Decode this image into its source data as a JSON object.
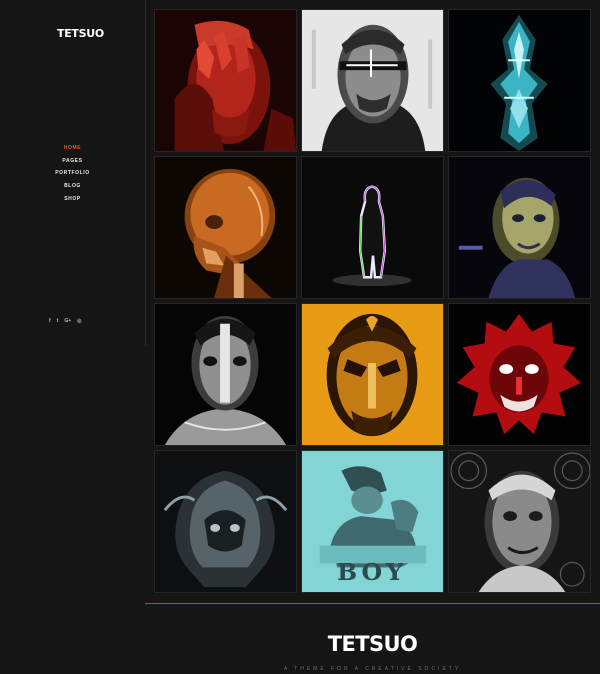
{
  "brand": {
    "name": "TETSUO",
    "tagline": "A THEME FOR A CREATIVE SOCIETY"
  },
  "nav": {
    "items": [
      {
        "label": "HOME",
        "active": true
      },
      {
        "label": "PAGES",
        "active": false
      },
      {
        "label": "PORTFOLIO",
        "active": false
      },
      {
        "label": "BLOG",
        "active": false
      },
      {
        "label": "SHOP",
        "active": false
      }
    ]
  },
  "social": {
    "icons": [
      {
        "name": "facebook-icon",
        "glyph": "f"
      },
      {
        "name": "twitter-icon",
        "glyph": "t"
      },
      {
        "name": "google-plus-icon",
        "glyph": "G+"
      },
      {
        "name": "instagram-icon",
        "glyph": "◎"
      }
    ]
  },
  "colors": {
    "accent": "#e2582d",
    "background": "#151515",
    "rule": "#b9482a"
  },
  "portfolio": {
    "tiles": [
      {
        "name": "red-face-artwork",
        "palette": "red"
      },
      {
        "name": "glitch-face-artwork",
        "palette": "gray"
      },
      {
        "name": "cyan-symmetry-artwork",
        "palette": "cyan"
      },
      {
        "name": "orange-xray-skull-artwork",
        "palette": "orange"
      },
      {
        "name": "glowing-figure-artwork",
        "palette": "glow"
      },
      {
        "name": "yellow-noise-face-artwork",
        "palette": "yellow"
      },
      {
        "name": "mirrored-face-artwork",
        "palette": "mono"
      },
      {
        "name": "orange-mirrored-face-artwork",
        "palette": "amber"
      },
      {
        "name": "red-lion-artwork",
        "palette": "crimson"
      },
      {
        "name": "alien-mask-artwork",
        "palette": "silver"
      },
      {
        "name": "cyan-boy-poster-artwork",
        "palette": "teal"
      },
      {
        "name": "halftone-face-artwork",
        "palette": "halftone"
      }
    ],
    "tile_text": {
      "cyan-boy-poster-artwork": "BOY"
    }
  }
}
